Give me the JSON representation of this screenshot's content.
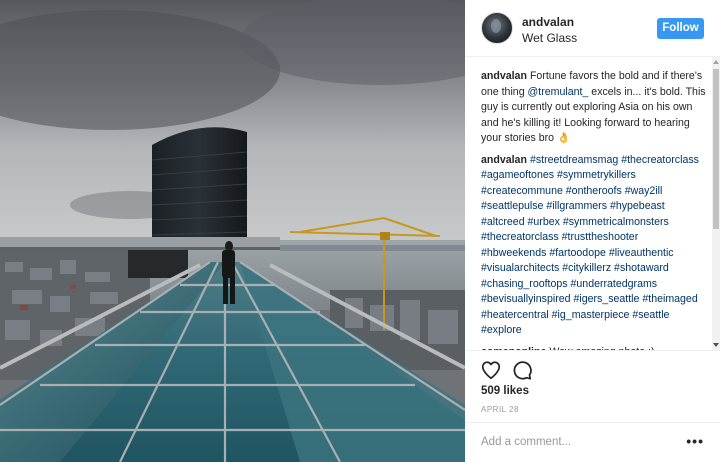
{
  "post": {
    "author": "andvalan",
    "location": "Wet Glass",
    "follow_label": "Follow",
    "image_alt": "Person standing on a glass rooftop above a city skyline with a construction crane"
  },
  "comments": [
    {
      "author": "andvalan",
      "parts": [
        {
          "t": "Fortune favors the bold and if there's one thing ",
          "tag": false
        },
        {
          "t": "@tremulant_",
          "tag": true
        },
        {
          "t": " excels in... it's bold. This guy is currently out exploring Asia on his own and he's killing it! Looking forward to hearing your stories bro ",
          "tag": false
        },
        {
          "t": "👌",
          "tag": false
        }
      ]
    },
    {
      "author": "andvalan",
      "parts": [
        {
          "t": "#streetdreamsmag #thecreatorclass #agameoftones #symmetrykillers #createcommune #ontheroofs #way2ill #seattlepulse #illgrammers #hypebeast #altcreed #urbex #symmetricalmonsters #thecreatorclass #trusttheshooter #hbweekends #fartoodope #liveauthentic #visualarchitects #citykillerz #shotaward #chasing_rooftops #underratedgrams #bevisuallyinspired #igers_seattle #theimaged #heatercentral #ig_masterpiece #seattle #explore",
          "tag": true
        }
      ]
    },
    {
      "author": "comenonline",
      "parts": [
        {
          "t": "Wow amazing photo :)",
          "tag": false
        }
      ]
    }
  ],
  "stats": {
    "likes": "509 likes",
    "date": "APRIL 28"
  },
  "comment_box": {
    "placeholder": "Add a comment...",
    "more_label": "•••"
  },
  "icons": {
    "like": "heart-icon",
    "comment": "comment-bubble-icon",
    "more": "more-options-icon"
  },
  "colors": {
    "follow_button": "#3897f0",
    "hashtag": "#003569",
    "muted": "#999999"
  }
}
